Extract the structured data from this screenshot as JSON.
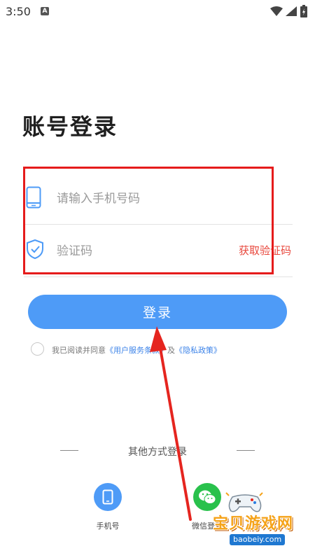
{
  "status_bar": {
    "time": "3:50",
    "notification_letter": "A"
  },
  "page": {
    "title": "账号登录"
  },
  "form": {
    "phone_placeholder": "请输入手机号码",
    "code_placeholder": "验证码",
    "get_code_label": "获取验证码"
  },
  "login_button": {
    "label": "登录"
  },
  "agreement": {
    "prefix": "我已阅读并同意",
    "service_terms": "《用户服务条款》",
    "and": "及",
    "privacy_policy": "《隐私政策》"
  },
  "other_login": {
    "title": "其他方式登录",
    "methods": [
      {
        "label": "手机号",
        "icon": "phone-icon"
      },
      {
        "label": "微信登录",
        "icon": "wechat-icon"
      }
    ]
  },
  "watermark": {
    "text": "宝贝游戏网",
    "url": "baobeiy.com"
  },
  "colors": {
    "accent": "#4e9bf7",
    "link": "#3c83e8",
    "get_code": "#e8473c",
    "highlight_box": "#e51b1b",
    "wechat": "#29c14c"
  }
}
